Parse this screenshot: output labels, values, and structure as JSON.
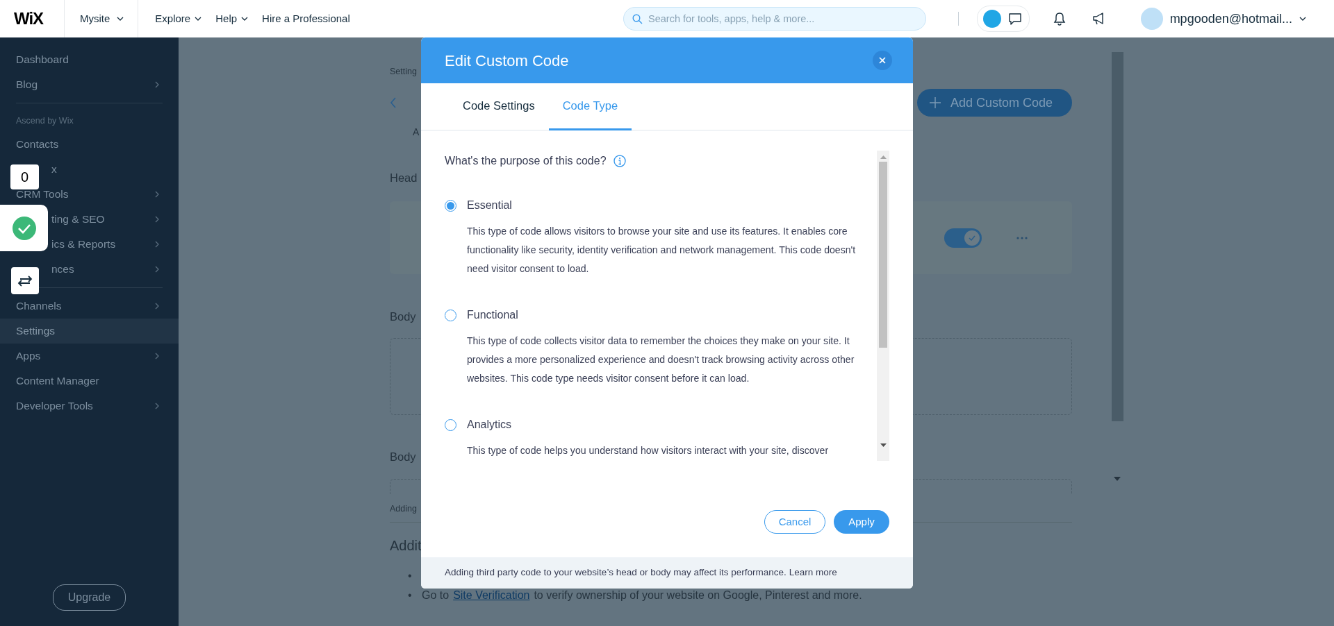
{
  "topbar": {
    "logo": "WiX",
    "site": "Mysite",
    "nav": [
      "Explore",
      "Help"
    ],
    "hire": "Hire a Professional",
    "search": {
      "placeholder": "Search for tools, apps, help & more..."
    },
    "account": "mpgooden@hotmail..."
  },
  "sidebar": {
    "items": [
      {
        "kind": "item",
        "label": "Dashboard",
        "submenu": false,
        "selected": false,
        "covered": false
      },
      {
        "kind": "item",
        "label": "Blog",
        "submenu": true,
        "selected": false,
        "covered": false
      },
      {
        "kind": "divider"
      },
      {
        "kind": "section",
        "label": "Ascend by Wix"
      },
      {
        "kind": "item",
        "label": "Contacts",
        "submenu": false,
        "selected": false,
        "covered": false
      },
      {
        "kind": "item",
        "label": "x",
        "submenu": false,
        "selected": false,
        "covered": true
      },
      {
        "kind": "item",
        "label": "CRM Tools",
        "submenu": true,
        "selected": false,
        "covered": false
      },
      {
        "kind": "item",
        "label": "ting & SEO",
        "submenu": true,
        "selected": false,
        "covered": true
      },
      {
        "kind": "item",
        "label": "ics & Reports",
        "submenu": true,
        "selected": false,
        "covered": true
      },
      {
        "kind": "item",
        "label": "nces",
        "submenu": true,
        "selected": false,
        "covered": true
      },
      {
        "kind": "divider"
      },
      {
        "kind": "item",
        "label": "Channels",
        "submenu": true,
        "selected": false,
        "covered": false
      },
      {
        "kind": "item",
        "label": "Settings",
        "submenu": false,
        "selected": true,
        "covered": false
      },
      {
        "kind": "item",
        "label": "Apps",
        "submenu": true,
        "selected": false,
        "covered": false
      },
      {
        "kind": "item",
        "label": "Content Manager",
        "submenu": false,
        "selected": false,
        "covered": false
      },
      {
        "kind": "item",
        "label": "Developer Tools",
        "submenu": true,
        "selected": false,
        "covered": false
      }
    ],
    "upgrade": "Upgrade"
  },
  "floating_widgets": {
    "counter": "0"
  },
  "page": {
    "breadcrumb": "Setting",
    "subtitle": "A",
    "add_button": "Add Custom Code",
    "head_label": "Head",
    "head_toggle_on": true,
    "body_label": "Body",
    "body_label_2": "Body",
    "note": "Adding",
    "heading": "Addit",
    "bullets": [
      {
        "marker": "•"
      },
      {
        "marker": "•",
        "before": "Go to",
        "link": "Site Verification",
        "after": "to verify ownership of your website on Google, Pinterest and more."
      }
    ]
  },
  "modal": {
    "title": "Edit Custom Code",
    "tabs": [
      {
        "label": "Code Settings",
        "selected": false
      },
      {
        "label": "Code Type",
        "selected": true
      }
    ],
    "question": "What's the purpose of this code?",
    "options": [
      {
        "label": "Essential",
        "selected": true,
        "description": "This type of code allows visitors to browse your site and use its features. It enables core functionality like security, identity verification and network management. This code doesn't need visitor consent to load."
      },
      {
        "label": "Functional",
        "selected": false,
        "description": "This type of code collects visitor data to remember the choices they make on your site. It provides a more personalized experience and doesn't track browsing activity across other websites. This code type needs visitor consent before it can load."
      },
      {
        "label": "Analytics",
        "selected": false,
        "description": "This type of code helps you understand how visitors interact with your site, discover"
      }
    ],
    "cancel": "Cancel",
    "apply": "Apply",
    "footer_text": "Adding third party code to your website’s head or body may affect its performance.",
    "footer_link": "Learn more"
  }
}
